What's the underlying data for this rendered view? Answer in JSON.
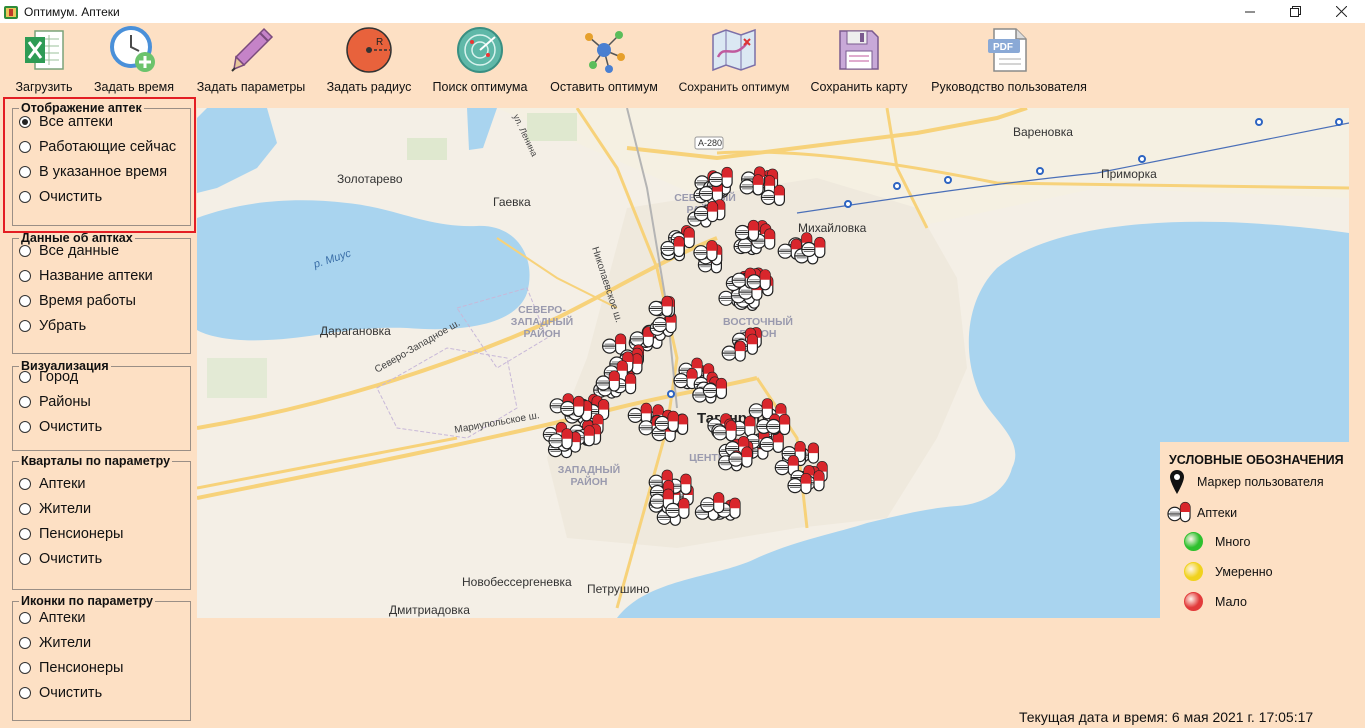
{
  "window": {
    "title": "Оптимум. Аптеки"
  },
  "toolbar": [
    {
      "label": "Загрузить",
      "icon": "excel-icon"
    },
    {
      "label": "Задать время",
      "icon": "clock-add-icon"
    },
    {
      "label": "Задать параметры",
      "icon": "pen-icon"
    },
    {
      "label": "Задать радиус",
      "icon": "radius-icon"
    },
    {
      "label": "Поиск оптимума",
      "icon": "radar-icon"
    },
    {
      "label": "Оставить оптимум",
      "icon": "network-icon"
    },
    {
      "label": "Сохранить оптимум",
      "icon": "map-route-icon"
    },
    {
      "label": "Сохранить карту",
      "icon": "floppy-icon"
    },
    {
      "label": "Руководство пользователя",
      "icon": "pdf-icon"
    }
  ],
  "groups": [
    {
      "title": "Отображение аптек",
      "options": [
        "Все аптеки",
        "Работающие сейчас",
        "В указанное время",
        "Очистить"
      ],
      "selected": 0
    },
    {
      "title": "Данные об аптках",
      "options": [
        "Все данные",
        "Название аптеки",
        "Время работы",
        "Убрать"
      ],
      "selected": -1
    },
    {
      "title": "Визуализация",
      "options": [
        "Город",
        "Районы",
        "Очистить"
      ],
      "selected": -1
    },
    {
      "title": "Кварталы по параметру",
      "options": [
        "Аптеки",
        "Жители",
        "Пенсионеры",
        "Очистить"
      ],
      "selected": -1
    },
    {
      "title": "Иконки по параметру",
      "options": [
        "Аптеки",
        "Жители",
        "Пенсионеры",
        "Очистить"
      ],
      "selected": -1
    }
  ],
  "map": {
    "labels": {
      "zolotarevo": "Золотарево",
      "gaevka": "Гаевка",
      "miusriver": "р. Миус",
      "daraganovka": "Дарагановка",
      "severozapadnoe": "Северо-Западное ш.",
      "nikolaevskoe": "Николаевское ш.",
      "mariupolskoe": "Мариупольское ш.",
      "lenina": "ул. Ленина",
      "a280": "А-280",
      "szrayon": "СЕВЕРО-\nЗАПАДНЫЙ\nРАЙОН",
      "zrayon": "ЗАПАДНЫЙ\nРАЙОН",
      "taganrog": "Таганрог",
      "mikhailovka": "Михайловка",
      "varenovka": "Вареновка",
      "primorka": "Приморка",
      "novobessergenevka": "Новобессергеневка",
      "petrushino": "Петрушино",
      "dmitriadovka": "Дмитриадовка",
      "vrayon": "ВОСТОЧНЫЙ\nРАЙОН",
      "crayon": "ЦЕНТР",
      "sevrayon": "СЕВЕРНЫЙ\nРАЙОН"
    },
    "pharmacy_marker_count": 180
  },
  "legend": {
    "title": "УСЛОВНЫЕ ОБОЗНАЧЕНИЯ",
    "user_marker": "Маркер пользователя",
    "pharmacies": "Аптеки",
    "levels": [
      {
        "label": "Много",
        "color": "#2ec02e"
      },
      {
        "label": "Умеренно",
        "color": "#f0d21e"
      },
      {
        "label": "Мало",
        "color": "#e23b3b"
      }
    ]
  },
  "status": {
    "datetime": "Текущая дата и время: 6 мая 2021 г. 17:05:17"
  },
  "colors": {
    "background": "#fde0c4",
    "highlight": "#e31e24",
    "sea": "#a9d4ef",
    "land": "#f4efe6",
    "road": "#f7d27a"
  }
}
